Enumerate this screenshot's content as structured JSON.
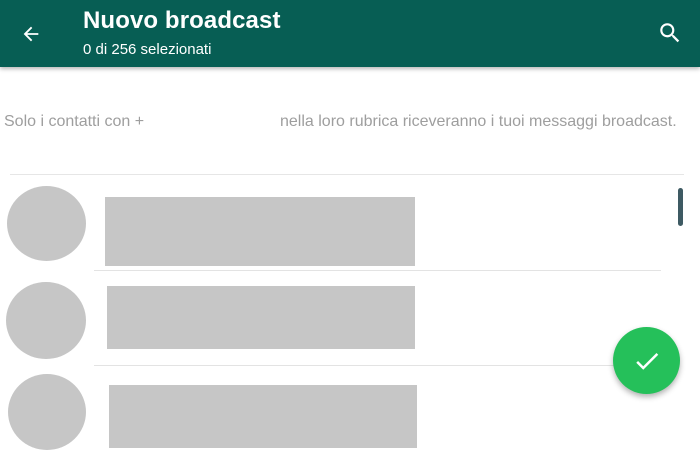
{
  "header": {
    "title": "Nuovo broadcast",
    "subtitle": "0 di 256 selezionati",
    "back_icon": "arrow-back-icon",
    "search_icon": "search-icon",
    "background_color": "#075e54"
  },
  "info": {
    "text_left": "Solo i contatti con +",
    "text_right": "nella loro rubrica riceveranno i tuoi messaggi broadcast."
  },
  "fab": {
    "icon": "checkmark-icon",
    "color": "#25c05a"
  },
  "placeholder_color": "#c6c6c6"
}
